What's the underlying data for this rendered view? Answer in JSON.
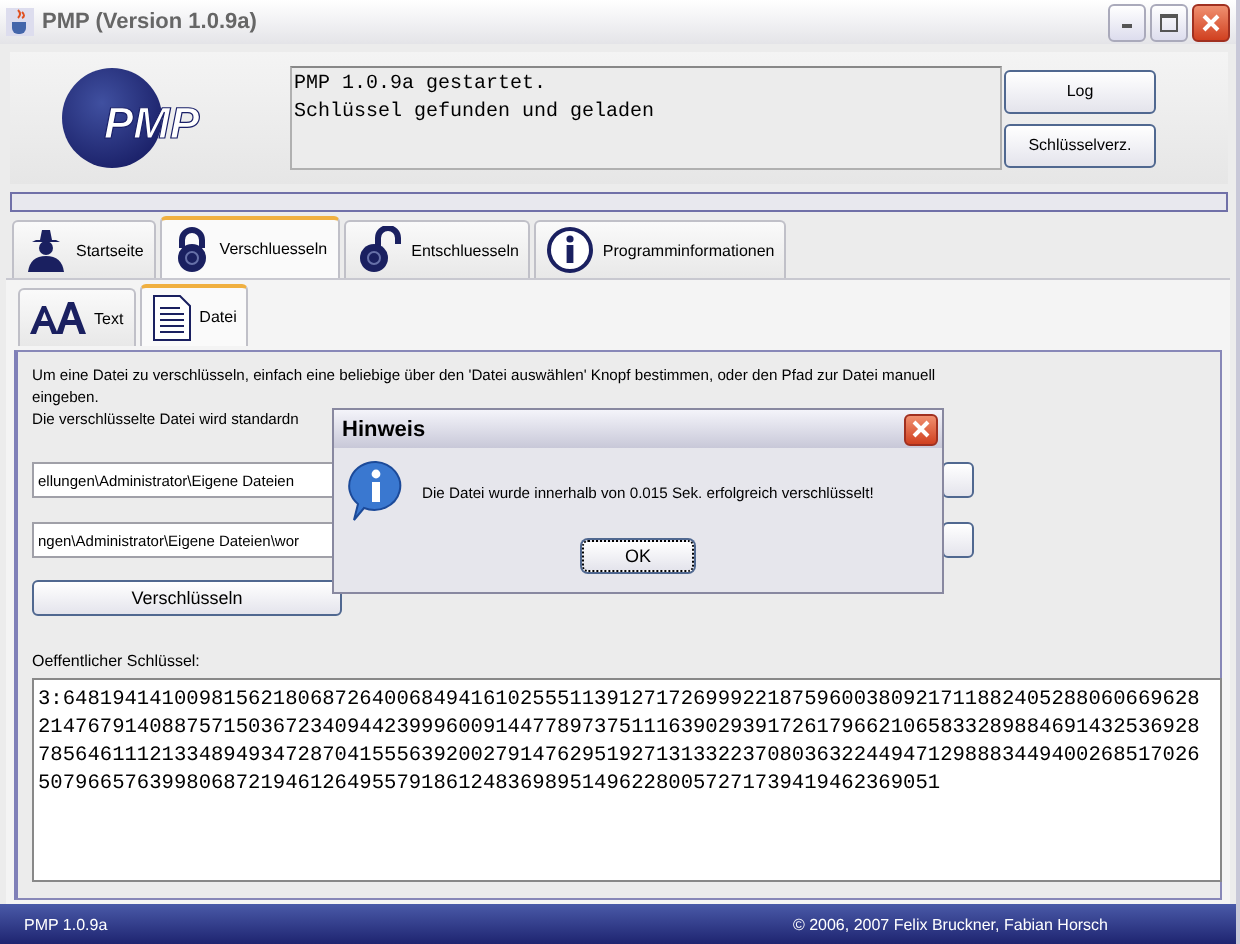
{
  "window": {
    "title": "PMP (Version 1.0.9a)"
  },
  "header": {
    "logo": "PMP",
    "log_lines": [
      "PMP 1.0.9a gestartet.",
      "Schlüssel gefunden und geladen"
    ],
    "buttons": [
      "Log",
      "Schlüsselverz."
    ]
  },
  "progress": {
    "level": 0
  },
  "tabs": [
    {
      "label": "Startseite",
      "selected": false
    },
    {
      "label": "Verschluesseln",
      "selected": true
    },
    {
      "label": "Entschluesseln",
      "selected": false
    },
    {
      "label": "Programminformationen",
      "selected": false
    }
  ],
  "subtabs": [
    {
      "label": "Text",
      "selected": false
    },
    {
      "label": "Datei",
      "selected": true
    }
  ],
  "description": [
    "Um eine Datei zu verschlüsseln, einfach eine beliebige über den 'Datei auswählen' Knopf bestimmen, oder den Pfad zur Datei manuell eingeben.",
    "Die verschlüsselte Datei wird standardn"
  ],
  "fields": [
    {
      "value": "ellungen\\Administrator\\Eigene Dateien"
    },
    {
      "value": "ngen\\Administrator\\Eigene Dateien\\wor"
    }
  ],
  "encrypt_button": "Verschlüsseln",
  "public_key": {
    "label": "Oeffentlicher Schlüssel:",
    "lines": [
      "3:64819414100981562180687264006849416102555113912717269992218759600380921711882405288060669628",
      "2147679140887571503672340944239996009144778973751116390293917261796621065833289884691432536928",
      "7856461112133489493472870415556392002791476295192713133223708036322449471298883449400268517026",
      "5079665763998068721946126495579186124836989514962280057271739419462369051"
    ]
  },
  "dialog": {
    "title": "Hinweis",
    "message": "Die Datei wurde innerhalb von 0.015 Sek. erfolgreich verschlüsselt!",
    "button": "OK"
  },
  "status_bar": {
    "left": "PMP 1.0.9a",
    "right": "© 2006, 2007 Felix Bruckner, Fabian Horsch"
  }
}
